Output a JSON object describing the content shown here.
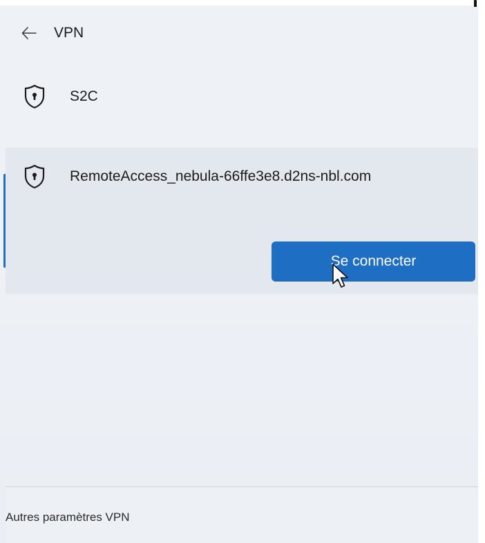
{
  "header": {
    "back_icon": "back-arrow-icon",
    "title": "VPN"
  },
  "vpn_list": {
    "items": [
      {
        "icon": "shield-lock-icon",
        "name": "S2C",
        "selected": false
      },
      {
        "icon": "shield-lock-icon",
        "name": "RemoteAccess_nebula-66ffe3e8.d2ns-nbl.com",
        "selected": true,
        "action_label": "Se connecter"
      }
    ]
  },
  "footer": {
    "link_label": "Autres paramètres VPN"
  },
  "colors": {
    "accent": "#1e6ec4",
    "background": "#eef2f7",
    "selected_background": "#e3e7ee"
  }
}
